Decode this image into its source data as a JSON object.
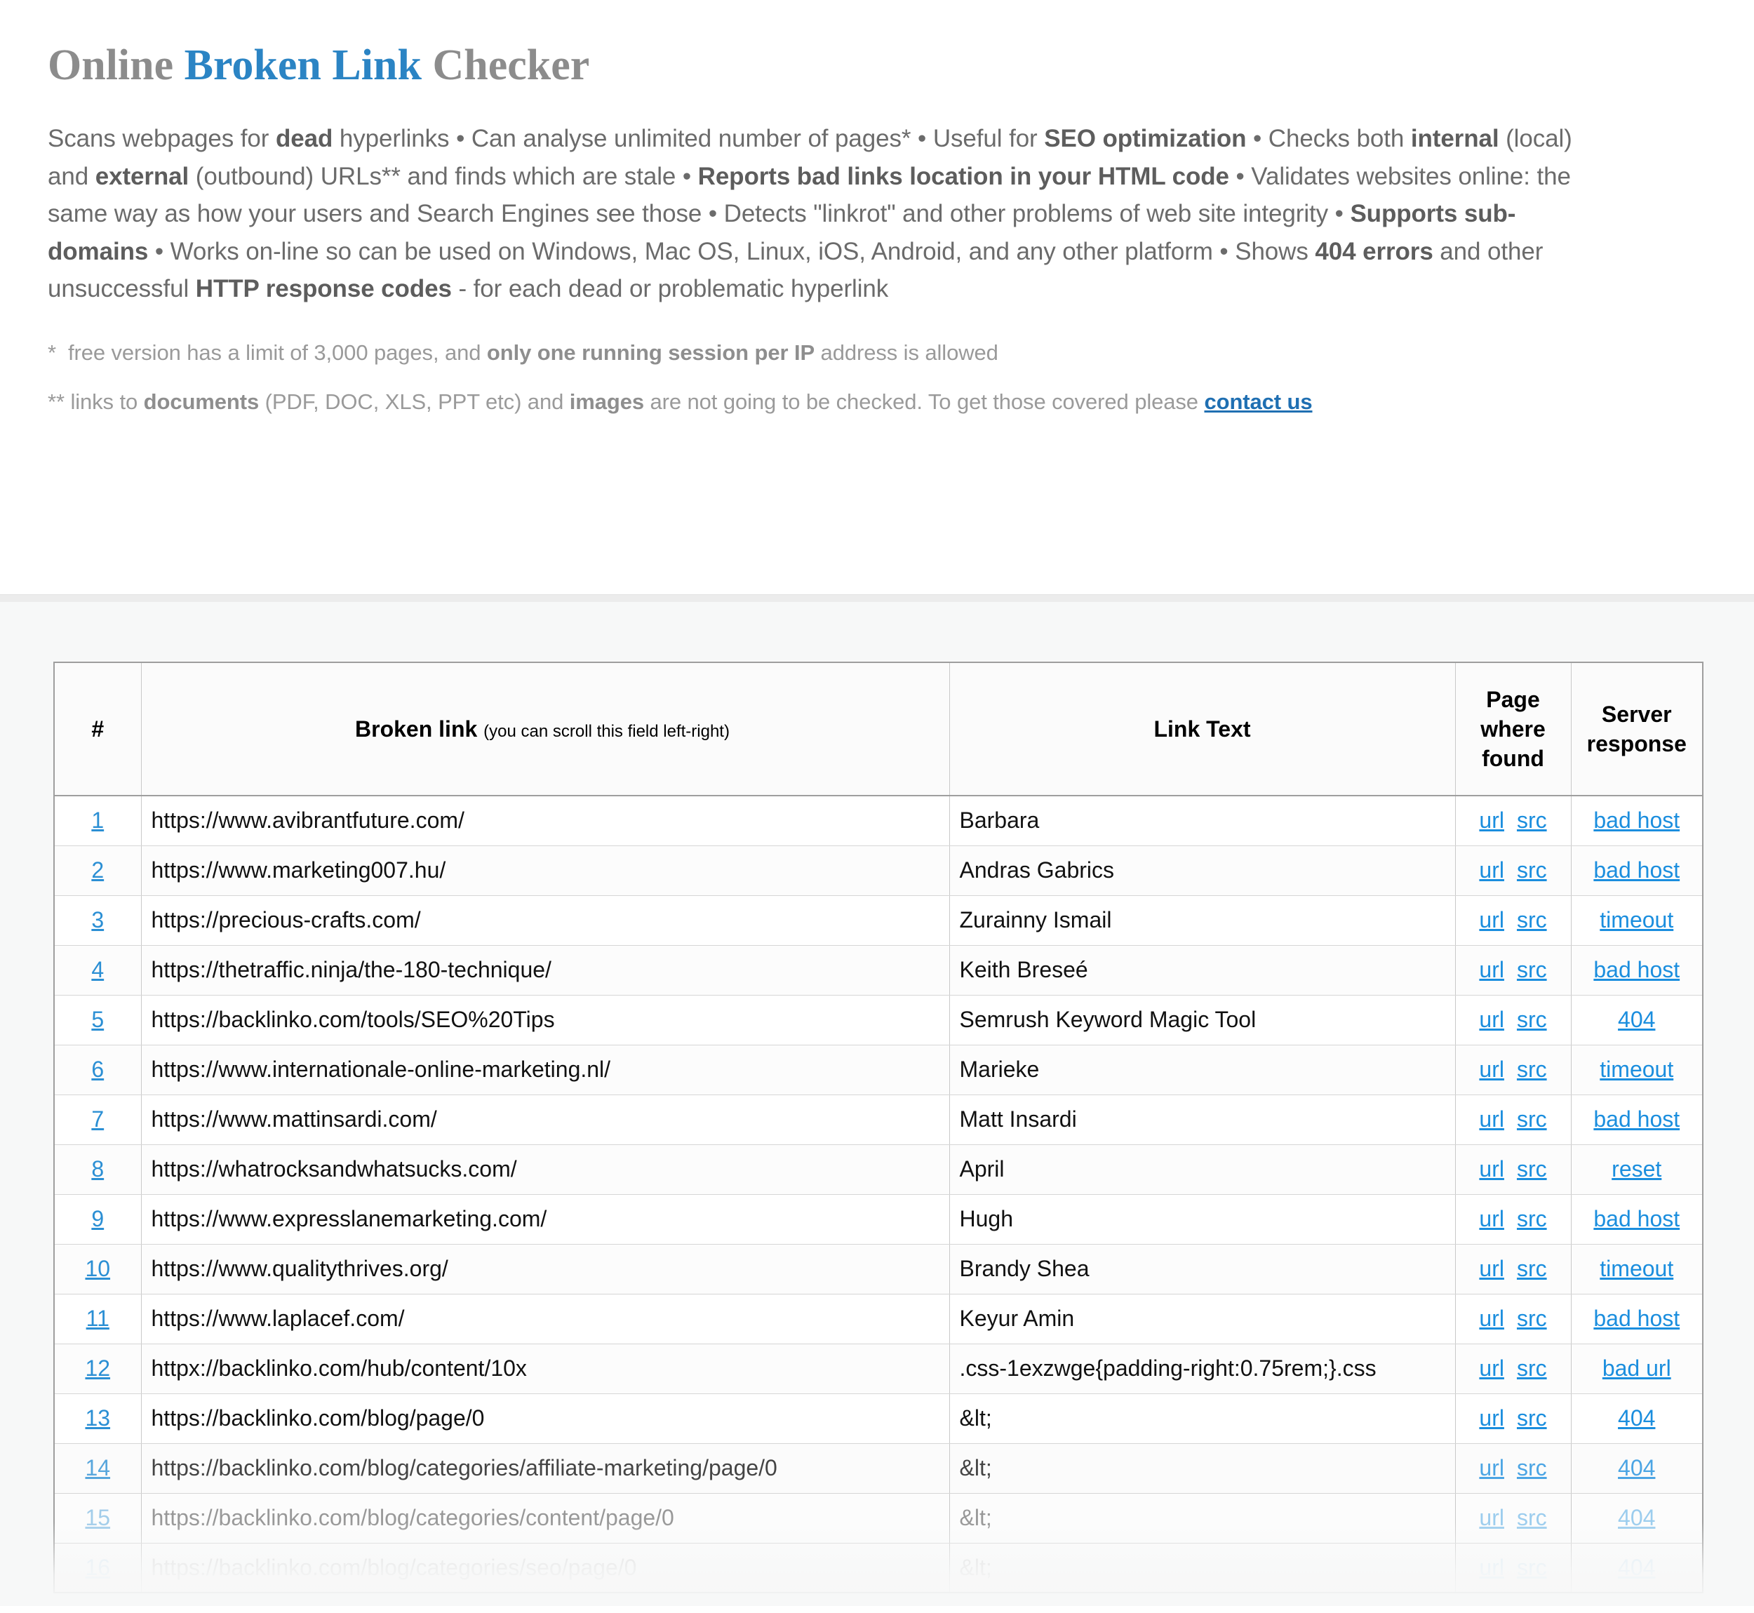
{
  "header": {
    "title_part1": "Online ",
    "title_accent": "Broken Link",
    "title_part2": " Checker",
    "description_html": "Scans webpages for <b>dead</b> hyperlinks • Can analyse unlimited number of pages* • Useful for <b>SEO optimization</b> • Checks both <b>internal</b> (local) and <b>external</b> (outbound) URLs** and finds which are stale • <b>Reports bad links location in your HTML code</b> • Validates websites online: the same way as how your users and Search Engines see those • Detects \"linkrot\" and other problems of web site integrity • <b>Supports sub-domains</b> • Works on-line so can be used on Windows, Mac OS, Linux, iOS, Android, and any other platform • Shows <b>404 errors</b> and other unsuccessful <b>HTTP response codes</b> - for each dead or problematic hyperlink",
    "footnote_1_html": "*&nbsp; free version has a limit of 3,000 pages, and <b>only one running session per IP</b> address is allowed",
    "footnote_2_html": "** links to <b>documents</b> (PDF, DOC, XLS, PPT etc) and <b>images</b> are not going to be checked. To get those covered please <a href=\"#\" data-name=\"contact-us-link\" data-interactable=\"true\">contact us</a>"
  },
  "table": {
    "columns": {
      "number": "#",
      "broken_link": "Broken link",
      "broken_link_hint": "(you can scroll this field left-right)",
      "link_text": "Link Text",
      "page_where_found": "Page where found",
      "server_response": "Server response"
    },
    "action_labels": {
      "url": "url",
      "src": "src"
    },
    "rows": [
      {
        "n": "1",
        "url": "https://www.avibrantfuture.com/",
        "text": "Barbara",
        "response": "bad host",
        "fade": ""
      },
      {
        "n": "2",
        "url": "https://www.marketing007.hu/",
        "text": "Andras Gabrics",
        "response": "bad host",
        "fade": ""
      },
      {
        "n": "3",
        "url": "https://precious-crafts.com/",
        "text": "Zurainny Ismail",
        "response": "timeout",
        "fade": ""
      },
      {
        "n": "4",
        "url": "https://thetraffic.ninja/the-180-technique/",
        "text": "Keith Breseé",
        "response": "bad host",
        "fade": ""
      },
      {
        "n": "5",
        "url": "https://backlinko.com/tools/SEO%20Tips",
        "text": "Semrush Keyword Magic Tool",
        "response": "404",
        "fade": ""
      },
      {
        "n": "6",
        "url": "https://www.internationale-online-marketing.nl/",
        "text": "Marieke",
        "response": "timeout",
        "fade": ""
      },
      {
        "n": "7",
        "url": "https://www.mattinsardi.com/",
        "text": "Matt Insardi",
        "response": "bad host",
        "fade": ""
      },
      {
        "n": "8",
        "url": "https://whatrocksandwhatsucks.com/",
        "text": "April",
        "response": "reset",
        "fade": ""
      },
      {
        "n": "9",
        "url": "https://www.expresslanemarketing.com/",
        "text": "Hugh",
        "response": "bad host",
        "fade": ""
      },
      {
        "n": "10",
        "url": "https://www.qualitythrives.org/",
        "text": "Brandy Shea",
        "response": "timeout",
        "fade": ""
      },
      {
        "n": "11",
        "url": "https://www.laplacef.com/",
        "text": "Keyur Amin",
        "response": "bad host",
        "fade": ""
      },
      {
        "n": "12",
        "url": "httpx://backlinko.com/hub/content/10x",
        "text": ".css-1exzwge{padding-right:0.75rem;}.css",
        "response": "bad url",
        "fade": ""
      },
      {
        "n": "13",
        "url": "https://backlinko.com/blog/page/0",
        "text": "&lt;",
        "response": "404",
        "fade": ""
      },
      {
        "n": "14",
        "url": "https://backlinko.com/blog/categories/affiliate-marketing/page/0",
        "text": "&lt;",
        "response": "404",
        "fade": "fade-1"
      },
      {
        "n": "15",
        "url": "https://backlinko.com/blog/categories/content/page/0",
        "text": "&lt;",
        "response": "404",
        "fade": "fade-2"
      },
      {
        "n": "16",
        "url": "https://backlinko.com/blog/categories/seo/page/0",
        "text": "&lt;",
        "response": "404",
        "fade": "fade-3"
      }
    ]
  },
  "colors": {
    "accent_blue": "#2b84c4",
    "link_blue": "#1b8ede",
    "title_gray": "#8c8c8c",
    "body_gray": "#6b6b6b",
    "footnote_gray": "#9a9a9a",
    "table_bg": "#f7f8f8"
  }
}
